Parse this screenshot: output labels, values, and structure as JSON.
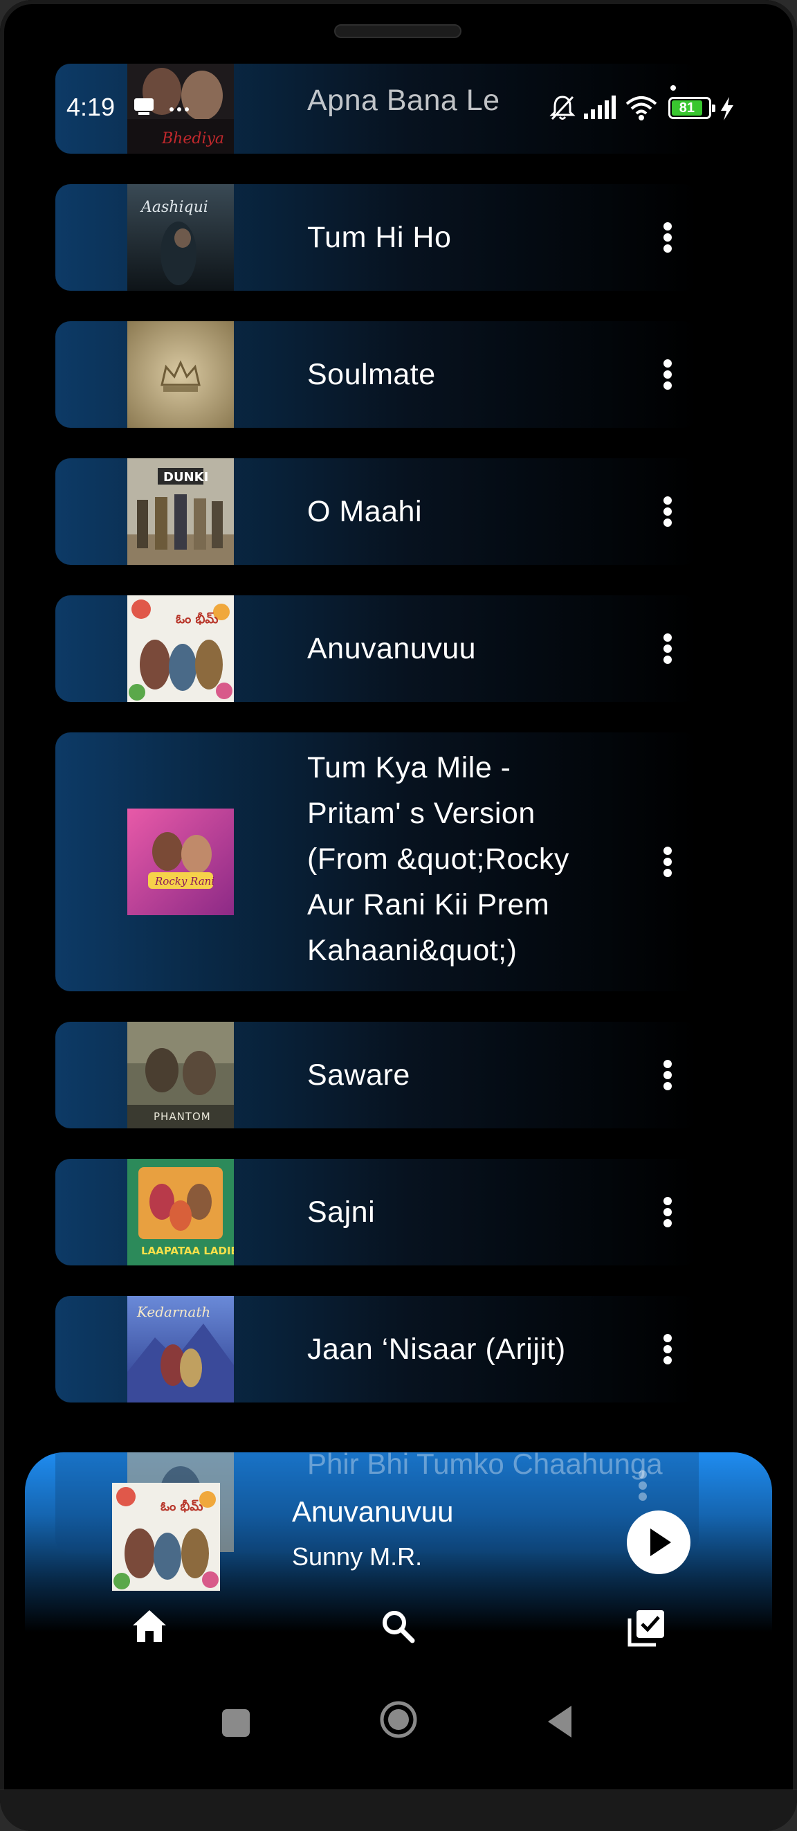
{
  "status_bar": {
    "time": "4:19",
    "battery_level": "81",
    "icons": [
      "notification-icon",
      "more-icon",
      "mute-icon",
      "signal-icon",
      "wifi-icon",
      "battery-icon",
      "charging-icon"
    ]
  },
  "songs": [
    {
      "title": "Apna Bana Le",
      "cover": "bhediya-cover"
    },
    {
      "title": "Tum Hi Ho",
      "cover": "aashiqui-cover"
    },
    {
      "title": "Soulmate",
      "cover": "crown-cover"
    },
    {
      "title": "O Maahi",
      "cover": "dunki-cover"
    },
    {
      "title": "Anuvanuvuu",
      "cover": "om-bheem-bush-cover"
    },
    {
      "title": "Tum Kya Mile - Pritam' s Version (From &quot;Rocky Aur Rani Kii Prem Kahaani&quot;)",
      "cover": "rocky-rani-cover"
    },
    {
      "title": "Saware",
      "cover": "phantom-cover"
    },
    {
      "title": "Sajni",
      "cover": "laapataa-ladies-cover"
    },
    {
      "title": "Jaan ‘Nisaar (Arijit)",
      "cover": "kedarnath-cover"
    },
    {
      "title": "Phir Bhi Tumko Chaahunga",
      "cover": "half-girlfriend-cover"
    }
  ],
  "now_playing": {
    "title": "Anuvanuvuu",
    "artist": "Sunny M.R.",
    "cover": "om-bheem-bush-cover",
    "state": "paused"
  },
  "bottom_nav": [
    {
      "name": "home",
      "icon": "home-icon",
      "active": true
    },
    {
      "name": "search",
      "icon": "search-icon",
      "active": false
    },
    {
      "name": "library",
      "icon": "library-icon",
      "active": false
    }
  ],
  "system_nav": [
    "recents-icon",
    "home-circle-icon",
    "back-icon"
  ],
  "colors": {
    "accent": "#1f8cf0",
    "card_gradient_start": "#0d3a66",
    "background": "#000000",
    "battery": "#39c72f"
  }
}
